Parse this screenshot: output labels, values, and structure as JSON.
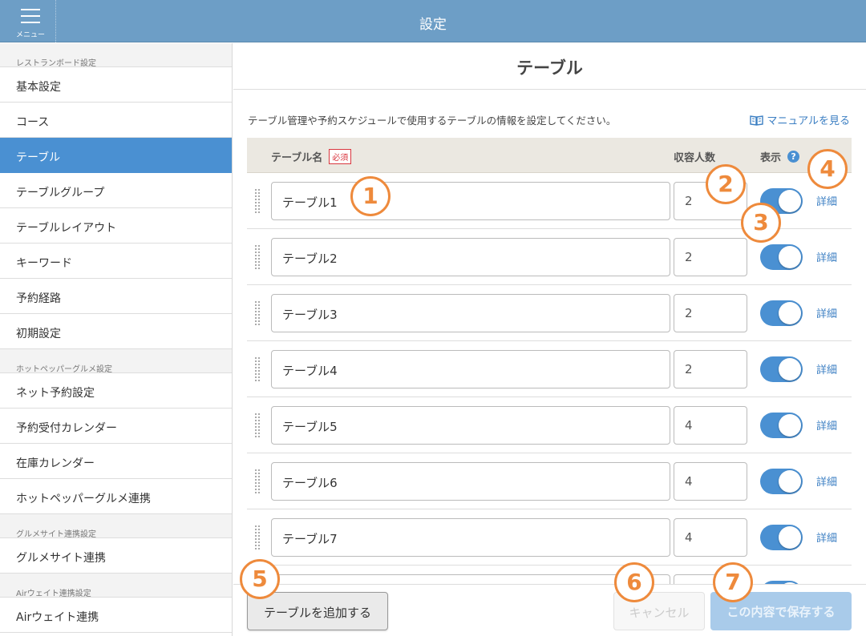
{
  "header": {
    "title": "設定",
    "menu_label": "メニュー"
  },
  "sidebar": {
    "sections": [
      {
        "heading": "レストランボード設定",
        "items": [
          "基本設定",
          "コース",
          "テーブル",
          "テーブルグループ",
          "テーブルレイアウト",
          "キーワード",
          "予約経路",
          "初期設定"
        ]
      },
      {
        "heading": "ホットペッパーグルメ設定",
        "items": [
          "ネット予約設定",
          "予約受付カレンダー",
          "在庫カレンダー",
          "ホットペッパーグルメ連携"
        ]
      },
      {
        "heading": "グルメサイト連携設定",
        "items": [
          "グルメサイト連携"
        ]
      },
      {
        "heading": "Airウェイト連携設定",
        "items": [
          "Airウェイト連携"
        ]
      }
    ],
    "active_item": "テーブル"
  },
  "main": {
    "title": "テーブル",
    "description": "テーブル管理や予約スケジュールで使用するテーブルの情報を設定してください。",
    "manual_link": "マニュアルを見る",
    "columns": {
      "name": "テーブル名",
      "required": "必須",
      "capacity": "収容人数",
      "display": "表示",
      "help": "?"
    },
    "rows": [
      {
        "name": "テーブル1",
        "capacity": "2",
        "display": true,
        "detail": "詳細"
      },
      {
        "name": "テーブル2",
        "capacity": "2",
        "display": true,
        "detail": "詳細"
      },
      {
        "name": "テーブル3",
        "capacity": "2",
        "display": true,
        "detail": "詳細"
      },
      {
        "name": "テーブル4",
        "capacity": "2",
        "display": true,
        "detail": "詳細"
      },
      {
        "name": "テーブル5",
        "capacity": "4",
        "display": true,
        "detail": "詳細"
      },
      {
        "name": "テーブル6",
        "capacity": "4",
        "display": true,
        "detail": "詳細"
      },
      {
        "name": "テーブル7",
        "capacity": "4",
        "display": true,
        "detail": "詳細"
      },
      {
        "name": "",
        "capacity": "",
        "display": true,
        "detail": ""
      }
    ]
  },
  "footer": {
    "add_label": "テーブルを追加する",
    "cancel_label": "キャンセル",
    "save_label": "この内容で保存する"
  },
  "markers": [
    "1",
    "2",
    "3",
    "4",
    "5",
    "6",
    "7"
  ],
  "colors": {
    "header": "#6d9ec6",
    "active": "#4a90d2",
    "marker": "#ee8a3c",
    "link": "#3c7fc3"
  }
}
